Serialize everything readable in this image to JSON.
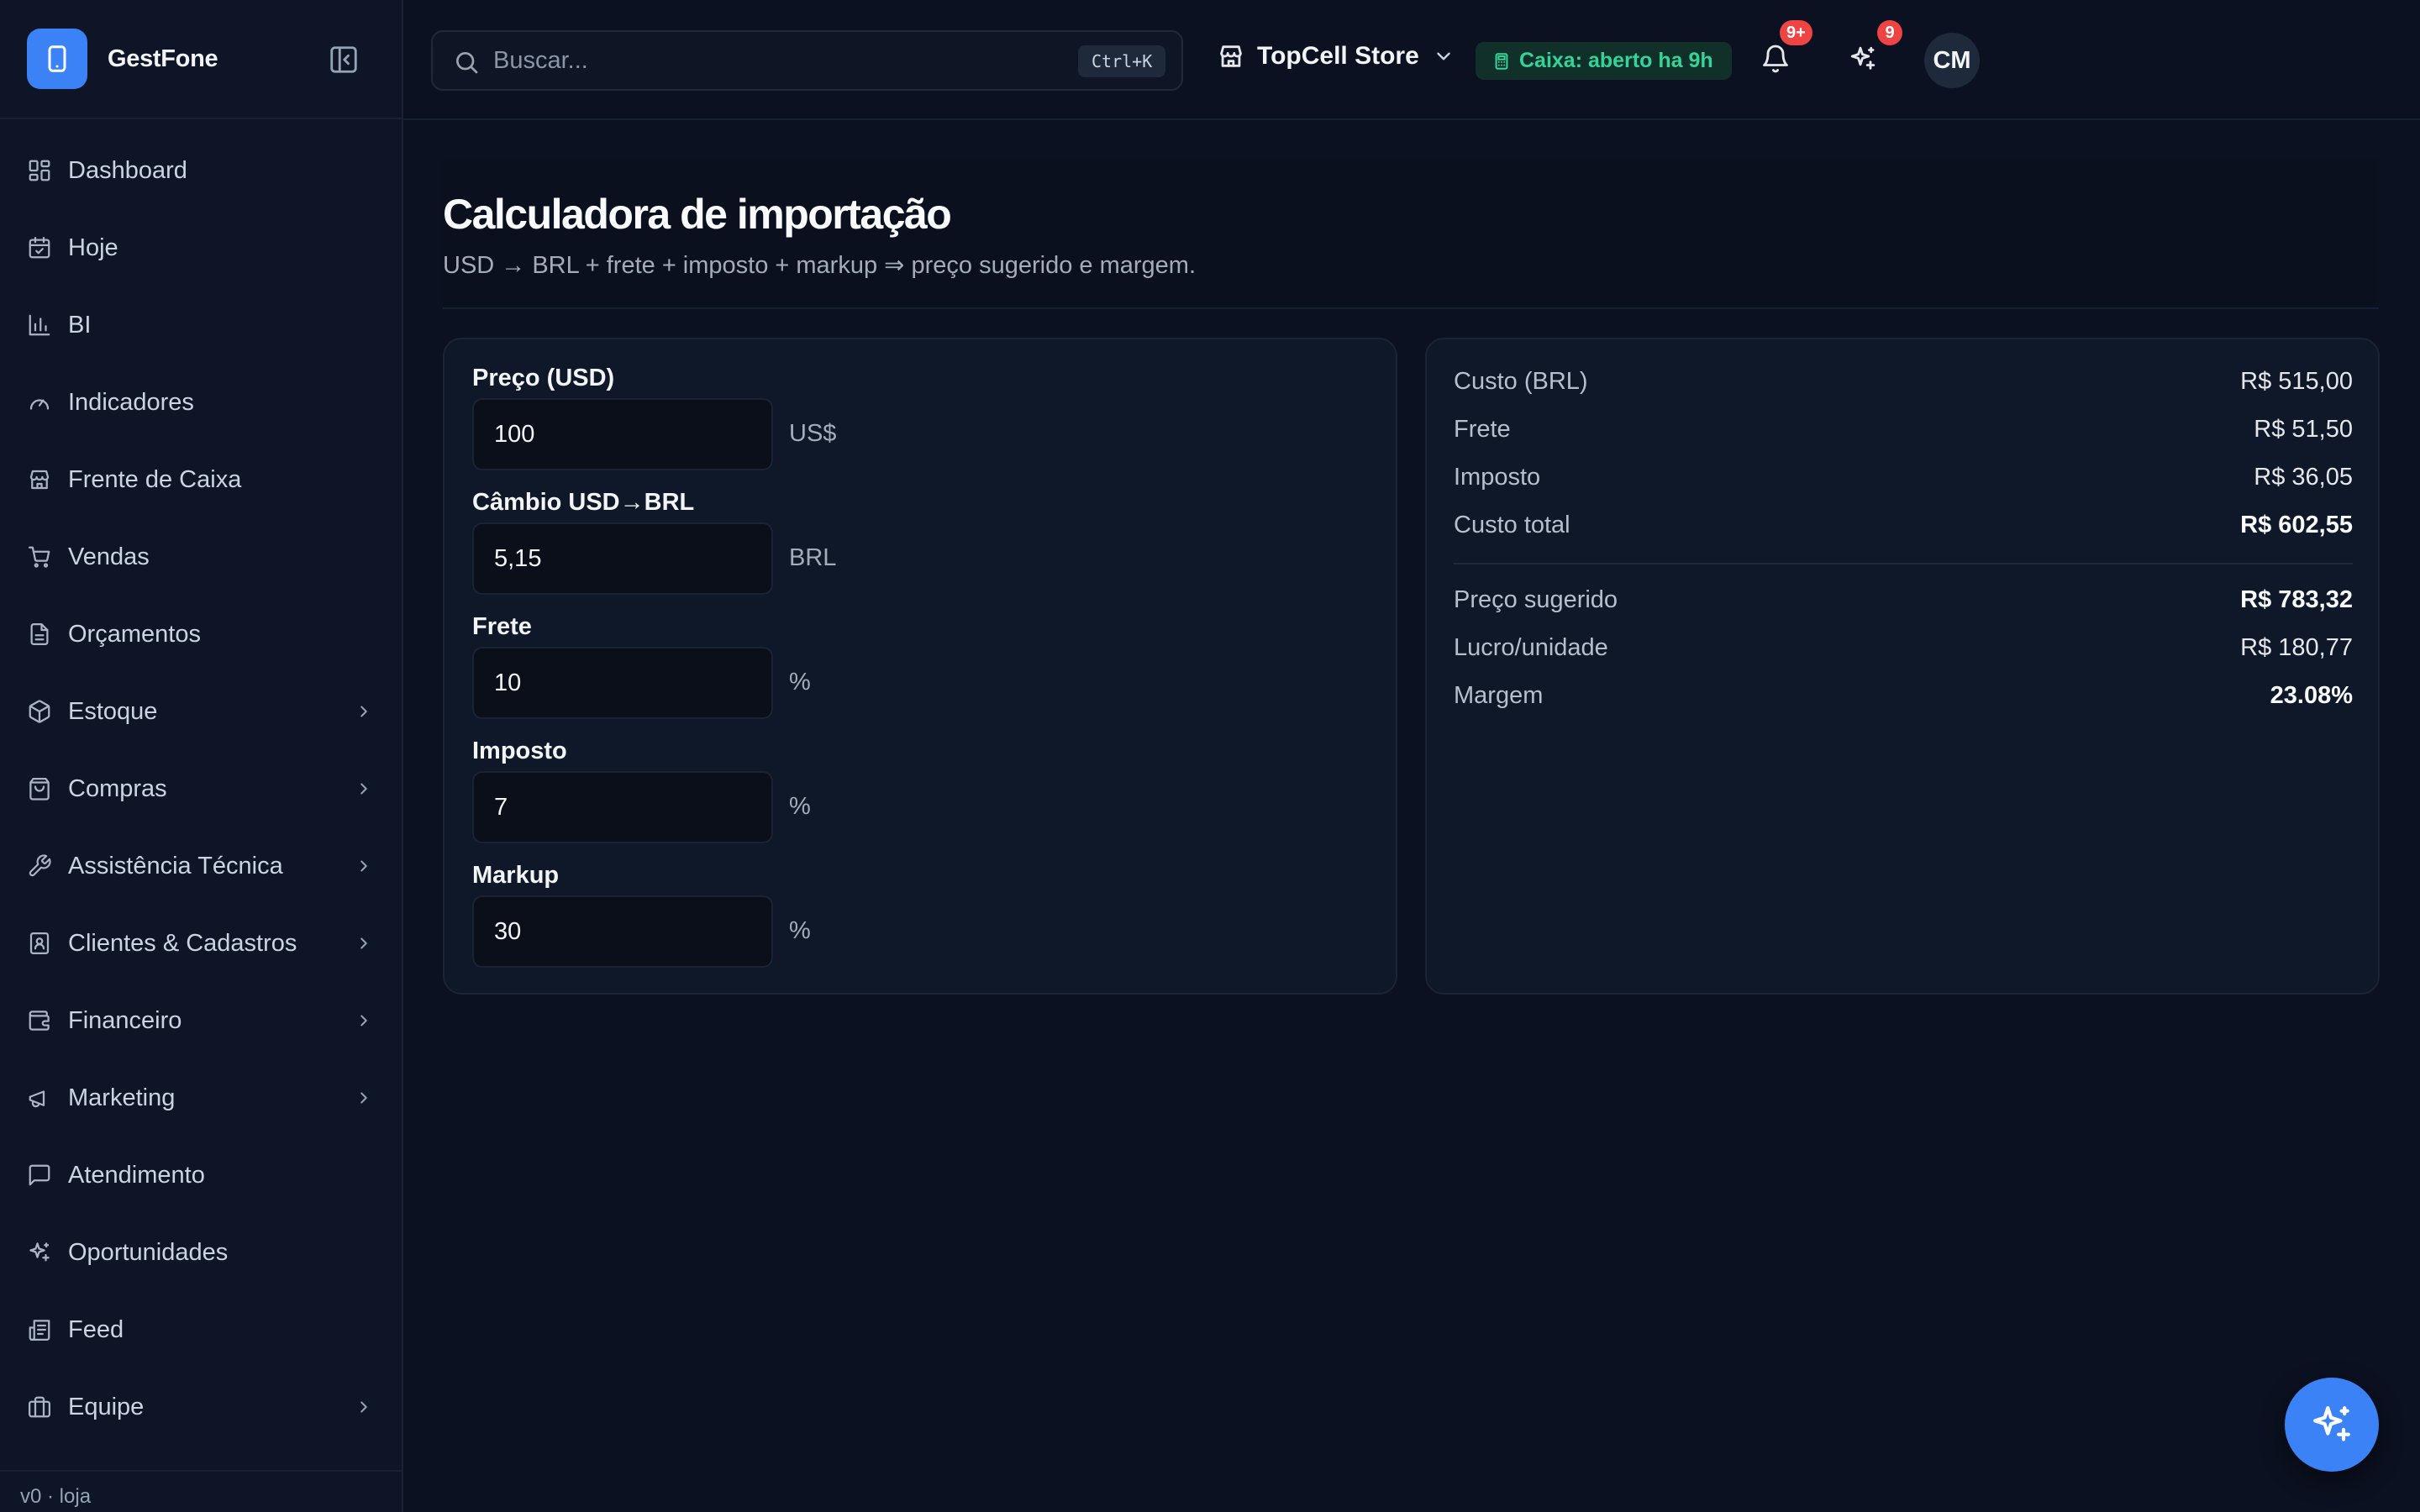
{
  "app": {
    "name": "GestFone",
    "version": "v0 · loja"
  },
  "colors": {
    "accent": "#3b82f6",
    "success": "#34d399",
    "danger": "#ef4444",
    "background": "#0b1120"
  },
  "sidebar": {
    "items": [
      {
        "label": "Dashboard",
        "icon": "dashboard-icon",
        "has_submenu": false
      },
      {
        "label": "Hoje",
        "icon": "calendar-check-icon",
        "has_submenu": false
      },
      {
        "label": "BI",
        "icon": "bar-chart-icon",
        "has_submenu": false
      },
      {
        "label": "Indicadores",
        "icon": "gauge-icon",
        "has_submenu": false
      },
      {
        "label": "Frente de Caixa",
        "icon": "store-icon",
        "has_submenu": false
      },
      {
        "label": "Vendas",
        "icon": "cart-icon",
        "has_submenu": false
      },
      {
        "label": "Orçamentos",
        "icon": "document-icon",
        "has_submenu": false
      },
      {
        "label": "Estoque",
        "icon": "box-icon",
        "has_submenu": true
      },
      {
        "label": "Compras",
        "icon": "shopping-bag-icon",
        "has_submenu": true
      },
      {
        "label": "Assistência Técnica",
        "icon": "wrench-icon",
        "has_submenu": true
      },
      {
        "label": "Clientes & Cadastros",
        "icon": "contact-book-icon",
        "has_submenu": true
      },
      {
        "label": "Financeiro",
        "icon": "wallet-icon",
        "has_submenu": true
      },
      {
        "label": "Marketing",
        "icon": "megaphone-icon",
        "has_submenu": true
      },
      {
        "label": "Atendimento",
        "icon": "chat-icon",
        "has_submenu": false
      },
      {
        "label": "Oportunidades",
        "icon": "sparkles-icon",
        "has_submenu": false
      },
      {
        "label": "Feed",
        "icon": "newspaper-icon",
        "has_submenu": false
      },
      {
        "label": "Equipe",
        "icon": "briefcase-icon",
        "has_submenu": true
      }
    ]
  },
  "topbar": {
    "search": {
      "placeholder": "Buscar...",
      "shortcut": "Ctrl+K"
    },
    "store": {
      "label": "TopCell Store"
    },
    "caixa": {
      "label": "Caixa: aberto ha 9h"
    },
    "notifications": {
      "badge": "9+"
    },
    "ai": {
      "badge": "9"
    },
    "avatar": {
      "initials": "CM"
    }
  },
  "page": {
    "title": "Calculadora de importação",
    "subtitle": "USD → BRL + frete + imposto + markup ⇒ preço sugerido e margem."
  },
  "form": {
    "fields": [
      {
        "label": "Preço (USD)",
        "value": "100",
        "unit": "US$"
      },
      {
        "label": "Câmbio USD→BRL",
        "value": "5,15",
        "unit": "BRL"
      },
      {
        "label": "Frete",
        "value": "10",
        "unit": "%"
      },
      {
        "label": "Imposto",
        "value": "7",
        "unit": "%"
      },
      {
        "label": "Markup",
        "value": "30",
        "unit": "%"
      }
    ]
  },
  "results": {
    "costs": [
      {
        "label": "Custo (BRL)",
        "value": "R$ 515,00",
        "bold": false
      },
      {
        "label": "Frete",
        "value": "R$ 51,50",
        "bold": false
      },
      {
        "label": "Imposto",
        "value": "R$ 36,05",
        "bold": false
      },
      {
        "label": "Custo total",
        "value": "R$ 602,55",
        "bold": true
      }
    ],
    "pricing": [
      {
        "label": "Preço sugerido",
        "value": "R$ 783,32",
        "bold": true
      },
      {
        "label": "Lucro/unidade",
        "value": "R$ 180,77",
        "bold": false
      },
      {
        "label": "Margem",
        "value": "23.08%",
        "bold": true
      }
    ]
  }
}
